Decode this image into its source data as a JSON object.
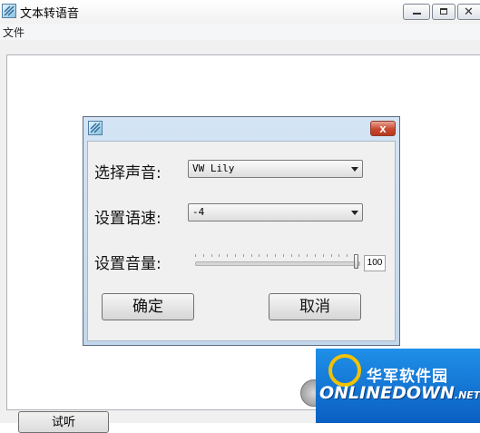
{
  "main_window": {
    "title": "文本转语音",
    "menu": [
      "文件"
    ],
    "try_button_label": "试听"
  },
  "dialog": {
    "close_glyph": "x",
    "voice": {
      "label": "选择声音:",
      "value": "VW Lily"
    },
    "speed": {
      "label": "设置语速:",
      "value": "-4"
    },
    "volume": {
      "label": "设置音量:",
      "value": "100",
      "level": 1.0
    },
    "ok_label": "确定",
    "cancel_label": "取消"
  },
  "watermark": {
    "cn": "华军软件园",
    "en": "ONLINEDOWN",
    "suffix": ".NET"
  },
  "colors": {
    "dialog_frame": "#c3d7ec",
    "close_red": "#c8482f",
    "watermark_blue": "#1578d8"
  }
}
